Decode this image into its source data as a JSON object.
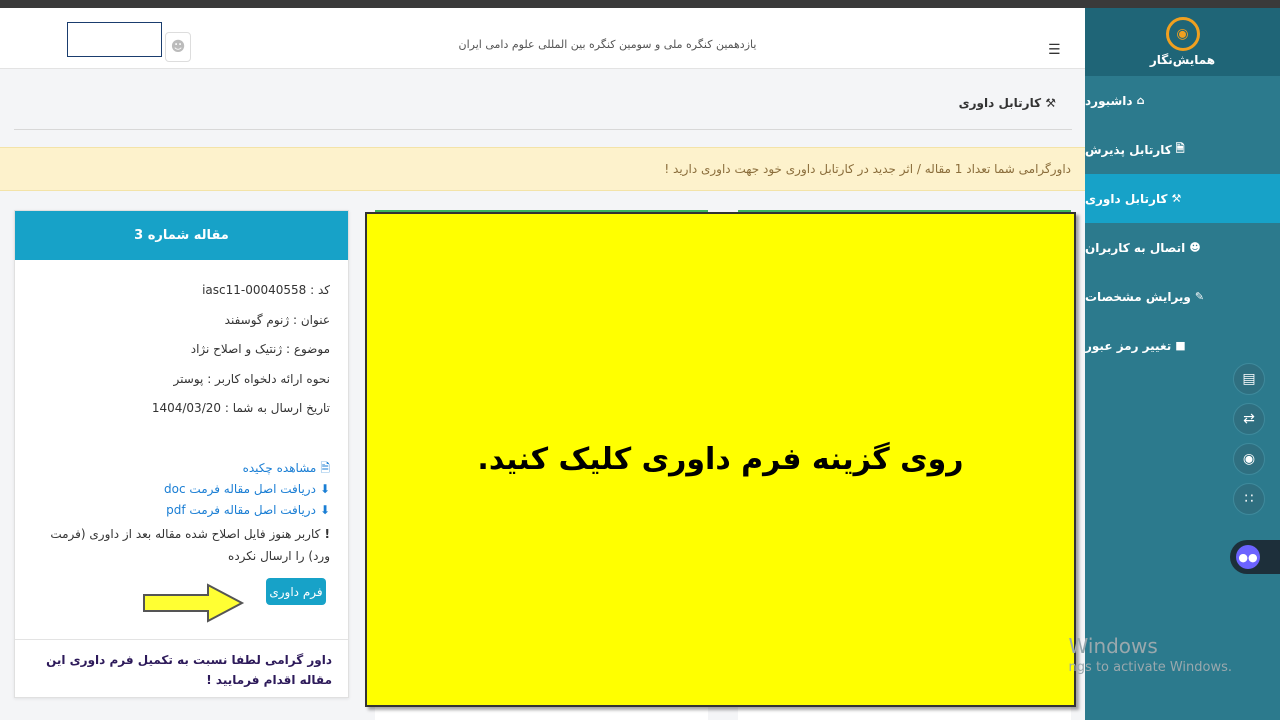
{
  "topbar": {
    "conference_title": "یازدهمین کنگره ملی و سومین کنگره بین المللی علوم دامی ایران",
    "menu_icon": "hamburger-icon",
    "user_icon": "user-icon"
  },
  "sidebar": {
    "logo_text": "همایش‌نگار",
    "items": [
      {
        "label": "داشبورد",
        "icon": "home-icon",
        "active": false
      },
      {
        "label": "کارتابل پذیرش",
        "icon": "document-icon",
        "active": false
      },
      {
        "label": "کارتابل داوری",
        "icon": "gavel-icon",
        "active": true
      },
      {
        "label": "اتصال به کاربران",
        "icon": "users-icon",
        "active": false
      },
      {
        "label": "ویرایش مشخصات",
        "icon": "edit-icon",
        "active": false
      },
      {
        "label": "تغییر رمز عبور",
        "icon": "lock-icon",
        "active": false
      }
    ],
    "tools": [
      "book-icon",
      "translate-icon",
      "broadcast-icon",
      "apps-icon",
      "assistant-icon"
    ]
  },
  "page": {
    "title": "کارتابل داوری",
    "notice": "داورگرامی شما تعداد 1 مقاله / اثر جدید در کارتابل داوری خود جهت داوری دارید !"
  },
  "article": {
    "header": "مقاله شماره 3",
    "code": "کد : iasc11-00040558",
    "title": "عنوان : ژنوم گوسفند",
    "topic": "موضوع : ژنتیک و اصلاح نژاد",
    "presentation": "نحوه ارائه دلخواه کاربر : پوستر",
    "sent_date": "تاریخ ارسال به شما : 1404/03/20",
    "link_abstract": "مشاهده چکیده",
    "link_doc": "دریافت اصل مقاله فرمت doc",
    "link_pdf": "دریافت اصل مقاله فرمت pdf",
    "warning": "کاربر هنوز فایل اصلاح شده مقاله بعد از داوری (فرمت ورد) را ارسال نکرده",
    "review_button": "فرم داوری",
    "footer_note": "داور گرامی لطفا نسبت به تکمیل فرم داوری این مقاله اقدام فرمایید !"
  },
  "overlay": {
    "instruction": "روی گزینه فرم داوری کلیک کنید."
  },
  "watermark": {
    "line1": "Windows",
    "line2": "ngs to activate Windows."
  },
  "colors": {
    "sidebar": "#2c7a8d",
    "accent": "#17a2c8",
    "overlay": "#ffff00",
    "notice_bg": "#fdf2cc"
  }
}
